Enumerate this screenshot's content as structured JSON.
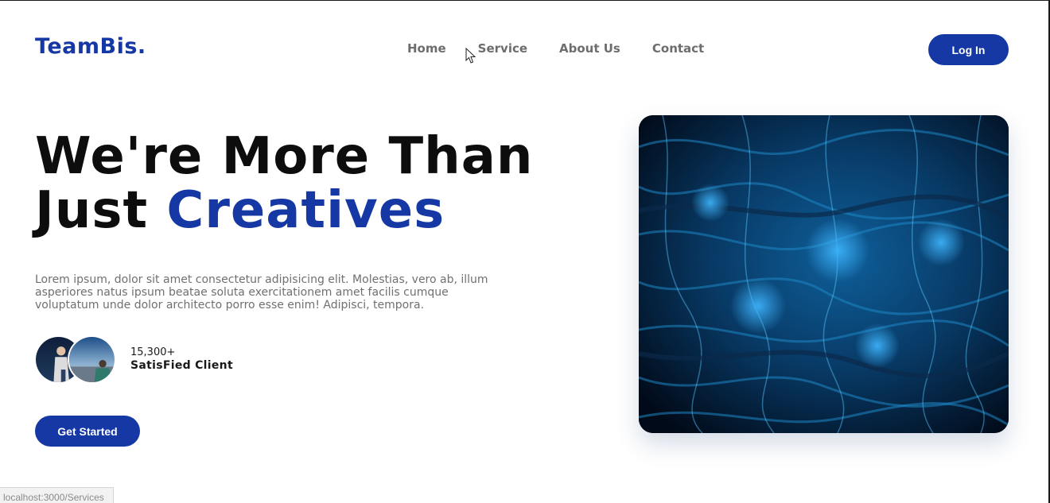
{
  "header": {
    "logo": "TeamBis.",
    "nav": [
      "Home",
      "Service",
      "About Us",
      "Contact"
    ],
    "login_label": "Log In"
  },
  "hero": {
    "title_line1": "We're More Than",
    "title_line2_prefix": "Just ",
    "title_line2_accent": "Creatives",
    "description": "Lorem ipsum, dolor sit amet consectetur adipisicing elit. Molestias, vero ab, illum asperiores natus ipsum beatae soluta exercitationem amet facilis cumque voluptatum unde dolor architecto porro esse enim! Adipisci, tempora.",
    "clients_count": "15,300+",
    "clients_label": "SatisFied Client",
    "cta_label": "Get Started"
  },
  "status_bar": {
    "url": "localhost:3000/Services"
  },
  "colors": {
    "brand": "#1538a5",
    "nav_text": "#6d6d6d",
    "body_text": "#707070"
  },
  "icons": {
    "cursor": "pointer-cursor-icon"
  }
}
